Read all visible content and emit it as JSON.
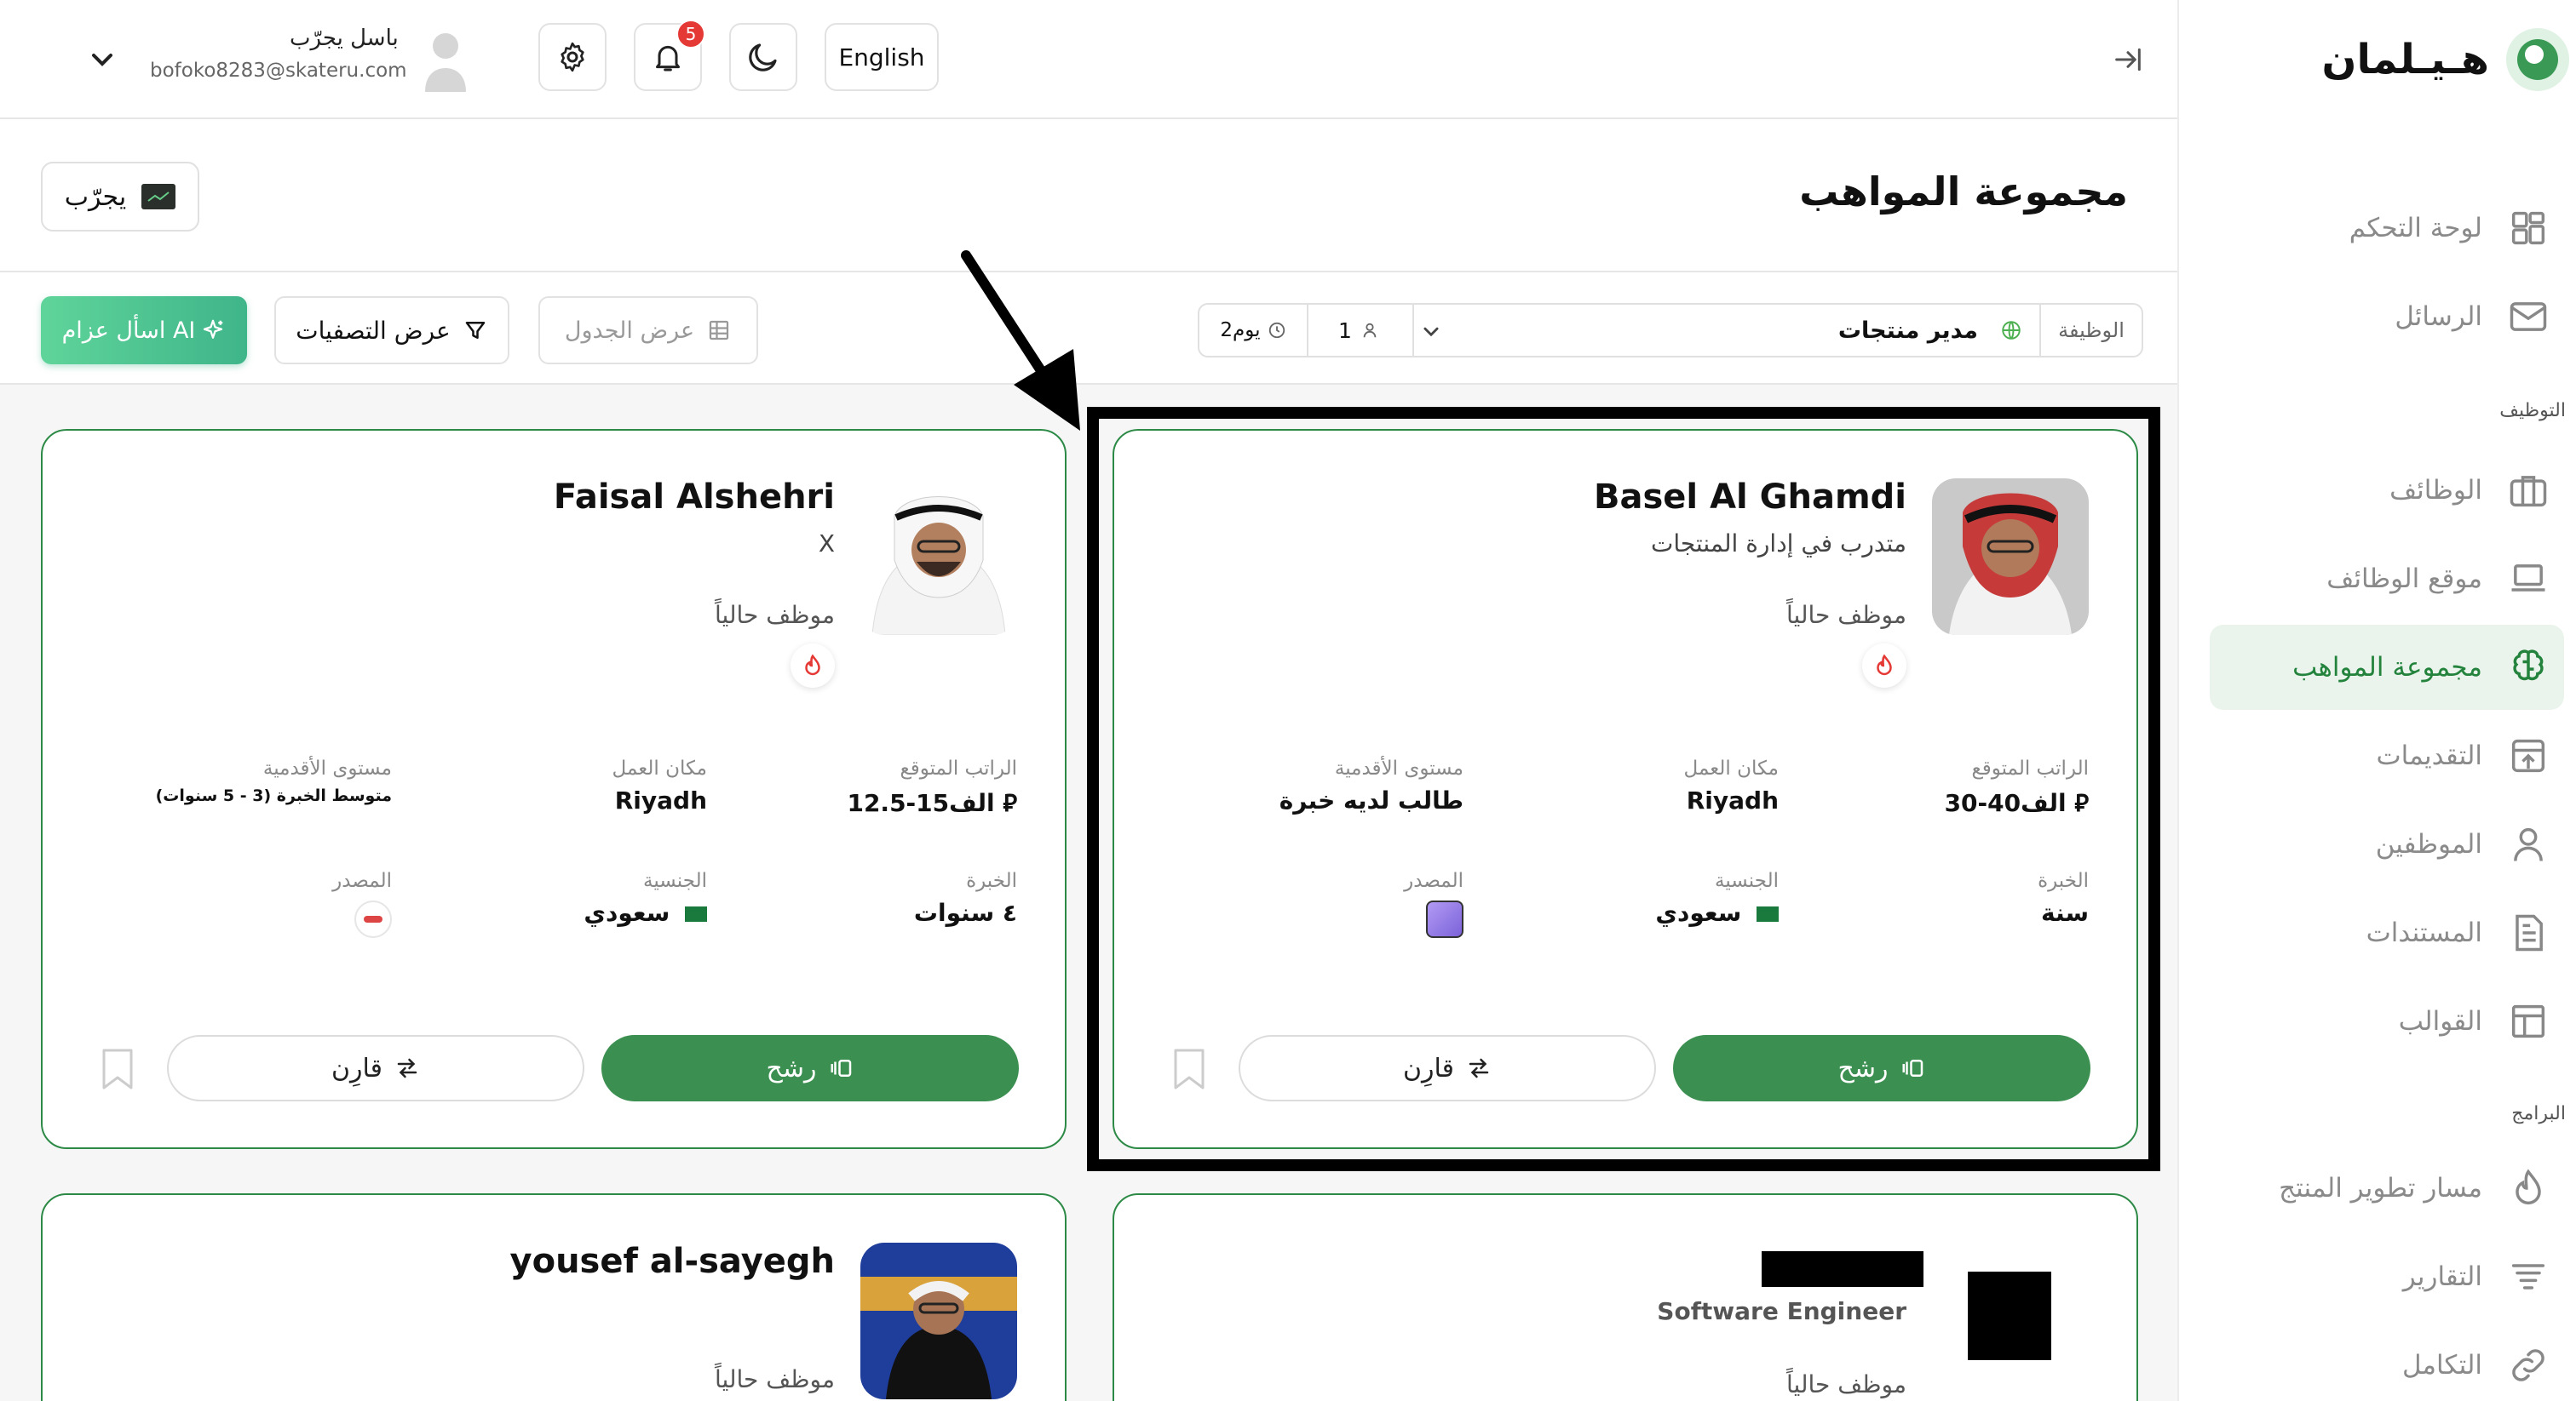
{
  "brand": {
    "name": "هـيـلمان",
    "logo_color": "#3a9a55"
  },
  "header": {
    "user_name": "باسل يجرّب",
    "user_email": "bofoko8283@skateru.com",
    "language_label": "English",
    "notification_count": "5",
    "icons": [
      "chevron-down-icon",
      "avatar",
      "gear-icon",
      "bell-icon",
      "moon-icon",
      "collapse-sidebar-icon"
    ]
  },
  "sidebar": {
    "items": [
      {
        "label": "لوحة التحكم",
        "icon": "dashboard-grid-icon"
      },
      {
        "label": "الرسائل",
        "icon": "mail-icon"
      },
      {
        "label": "الوظائف",
        "icon": "briefcase-icon"
      },
      {
        "label": "موقع الوظائف",
        "icon": "laptop-icon"
      },
      {
        "label": "مجموعة المواهب",
        "icon": "brain-icon",
        "active": true
      },
      {
        "label": "التقديمات",
        "icon": "inbox-upload-icon"
      },
      {
        "label": "الموظفين",
        "icon": "user-icon"
      },
      {
        "label": "المستندات",
        "icon": "document-icon"
      },
      {
        "label": "القوالب",
        "icon": "template-icon"
      },
      {
        "label": "مسار تطوير المنتج",
        "icon": "flame-icon"
      },
      {
        "label": "التقارير",
        "icon": "report-lines-icon"
      },
      {
        "label": "التكامل",
        "icon": "link-icon"
      }
    ],
    "sections": {
      "hiring": "التوظيف",
      "programs": "البرامج"
    }
  },
  "page": {
    "title": "مجموعة المواهب",
    "company_button": "يجرّب"
  },
  "toolbar": {
    "job_label": "الوظيفة",
    "job_value": "مدير منتجات",
    "count": "1",
    "days": "2يوم",
    "table_view": "عرض الجدول",
    "filters": "عرض التصفيات",
    "ask_ai": "اسأل عزام AI"
  },
  "card_labels": {
    "expected_salary": "الراتب المتوقع",
    "work_location": "مكان العمل",
    "seniority": "مستوى الأقدمية",
    "experience": "الخبرة",
    "nationality": "الجنسية",
    "source": "المصدر",
    "nominate": "رشح",
    "compare": "قارِن",
    "status": "موظف حالياً"
  },
  "cards": [
    {
      "name": "Basel Al Ghamdi",
      "subtitle": "متدرب في إدارة المنتجات",
      "salary": "30-40الف",
      "location": "Riyadh",
      "seniority": "طالب لديه خبرة",
      "experience": "سنة",
      "nationality": "سعودي"
    },
    {
      "name": "Faisal Alshehri",
      "subtitle": "X",
      "salary": "12.5-15الف",
      "location": "Riyadh",
      "seniority": "متوسط الخبرة (3 - 5 سنوات)",
      "experience": "٤ سنوات",
      "nationality": "سعودي"
    },
    {
      "name": "",
      "subtitle": "Software Engineer"
    },
    {
      "name": "yousef al-sayegh",
      "subtitle": ""
    }
  ],
  "colors": {
    "primary": "#3b8f50",
    "accent": "#2d8a46",
    "badge": "#e53935",
    "ai_gradient_start": "#5fd49a",
    "ai_gradient_end": "#3fb58a"
  }
}
